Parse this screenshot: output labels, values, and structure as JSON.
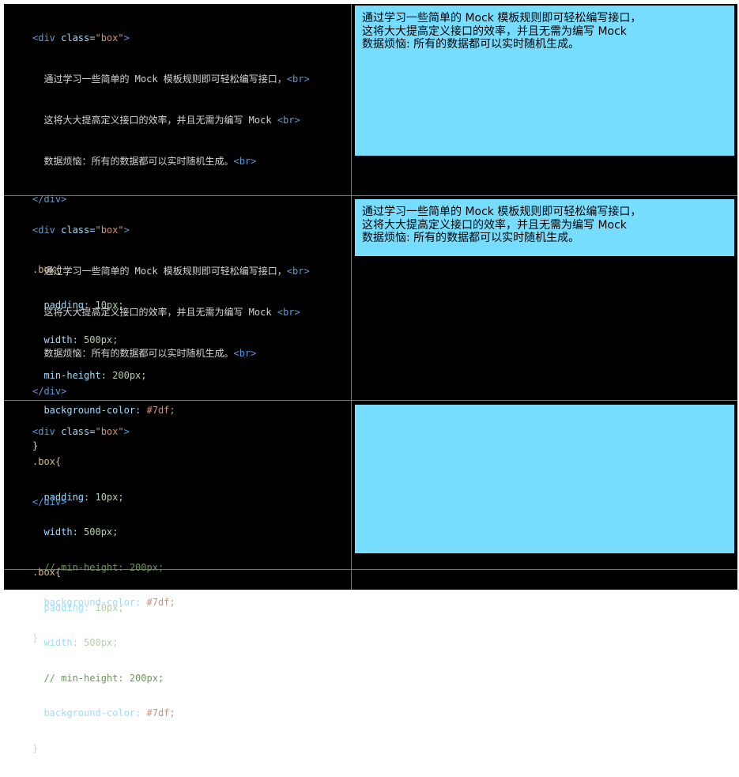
{
  "panels": [
    {
      "code": {
        "open_tag": "<div",
        "attr": " class=",
        "attr_value": "\"box\"",
        "open_close": ">",
        "body_lines": [
          "通过学习一些简单的 Mock 模板规则即可轻松编写接口，",
          "这将大大提高定义接口的效率，并且无需为编写 Mock ",
          "数据烦恼：所有的数据都可以实时随机生成。"
        ],
        "br": "<br>",
        "close_tag": "</div>",
        "selector": ".box{",
        "padding_prop": "padding:",
        "padding_val": " 10px;",
        "width_prop": "width:",
        "width_val": " 500px;",
        "minh_prop": "min-height:",
        "minh_val": " 200px;",
        "bg_prop": "background-color:",
        "bg_val": " #7df;",
        "close_brace": "}"
      },
      "box_lines": [
        "通过学习一些简单的 Mock 模板规则即可轻松编写接口，",
        "这将大大提高定义接口的效率，并且无需为编写 Mock",
        "数据烦恼: 所有的数据都可以实时随机生成。"
      ]
    },
    {
      "code": {
        "open_tag": "<div",
        "attr": " class=",
        "attr_value": "\"box\"",
        "open_close": ">",
        "body_lines": [
          "通过学习一些简单的 Mock 模板规则即可轻松编写接口，",
          "这将大大提高定义接口的效率，并且无需为编写 Mock ",
          "数据烦恼：所有的数据都可以实时随机生成。"
        ],
        "br": "<br>",
        "close_tag": "</div>",
        "selector": ".box{",
        "padding_prop": "padding:",
        "padding_val": " 10px;",
        "width_prop": "width:",
        "width_val": " 500px;",
        "minh_comment": "// min-height: 200px;",
        "bg_prop": "background-color:",
        "bg_val": " #7df;",
        "close_brace": "}"
      },
      "box_lines": [
        "通过学习一些简单的 Mock 模板规则即可轻松编写接口，",
        "这将大大提高定义接口的效率，并且无需为编写 Mock",
        "数据烦恼: 所有的数据都可以实时随机生成。"
      ]
    },
    {
      "code": {
        "open_tag": "<div",
        "attr": " class=",
        "attr_value": "\"box\"",
        "open_close": ">",
        "close_tag": "</div>",
        "selector": ".box{",
        "padding_prop": "padding:",
        "padding_val": " 10px;",
        "width_prop": "width:",
        "width_val": " 500px;",
        "minh_comment": "// min-height: 200px;",
        "bg_prop": "background-color:",
        "bg_val": " #7df;",
        "close_brace": "}"
      }
    }
  ],
  "colors": {
    "background": "#000000",
    "box": "#77ddff",
    "tag": "#569cd6",
    "string": "#ce9178",
    "selector": "#d7ba7d",
    "property": "#9cdcfe",
    "number": "#b5cea8",
    "comment": "#6a9955"
  }
}
